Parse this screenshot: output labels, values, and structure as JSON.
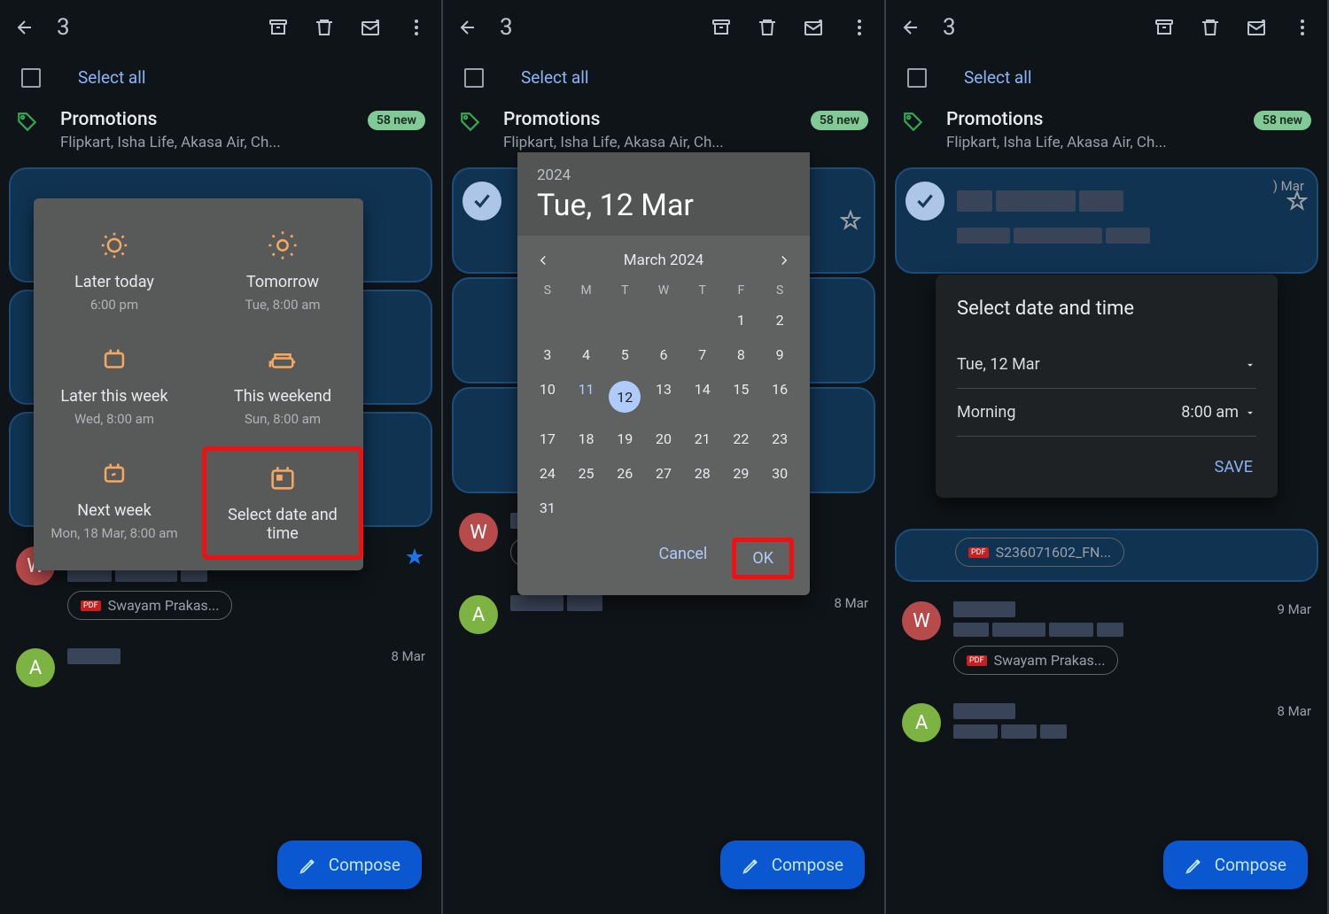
{
  "topbar": {
    "count": "3"
  },
  "selectall": "Select all",
  "promotions": {
    "title": "Promotions",
    "sub": "Flipkart, Isha Life, Akasa Air, Ch...",
    "badge": "58 new"
  },
  "snooze": {
    "later_today": {
      "label": "Later today",
      "sub": "6:00 pm"
    },
    "tomorrow": {
      "label": "Tomorrow",
      "sub": "Tue, 8:00 am"
    },
    "later_week": {
      "label": "Later this week",
      "sub": "Wed, 8:00 am"
    },
    "weekend": {
      "label": "This weekend",
      "sub": "Sun, 8:00 am"
    },
    "next_week": {
      "label": "Next week",
      "sub": "Mon, 18 Mar, 8:00 am"
    },
    "select_dt": {
      "label": "Select date and time"
    }
  },
  "calendar": {
    "year": "2024",
    "selected_date": "Tue, 12 Mar",
    "month_label": "March 2024",
    "dow": [
      "S",
      "M",
      "T",
      "W",
      "T",
      "F",
      "S"
    ],
    "weeks": [
      [
        "",
        "",
        "",
        "",
        "",
        "1",
        "2"
      ],
      [
        "3",
        "4",
        "5",
        "6",
        "7",
        "8",
        "9"
      ],
      [
        "10",
        "11",
        "12",
        "13",
        "14",
        "15",
        "16"
      ],
      [
        "17",
        "18",
        "19",
        "20",
        "21",
        "22",
        "23"
      ],
      [
        "24",
        "25",
        "26",
        "27",
        "28",
        "29",
        "30"
      ],
      [
        "31",
        "",
        "",
        "",
        "",
        "",
        ""
      ]
    ],
    "selected_day": "12",
    "today_day": "11",
    "cancel": "Cancel",
    "ok": "OK"
  },
  "sdt": {
    "title": "Select date and time",
    "date": "Tue, 12 Mar",
    "time_label": "Morning",
    "time_value": "8:00 am",
    "save": "SAVE"
  },
  "emails": {
    "card_date": ") Mar",
    "w_date": "9 Mar",
    "a_date": "8 Mar",
    "attach1": "Swayam Prakas...",
    "attach2": "S236071602_FN...",
    "w_letter": "W",
    "a_letter": "A"
  },
  "compose": "Compose"
}
